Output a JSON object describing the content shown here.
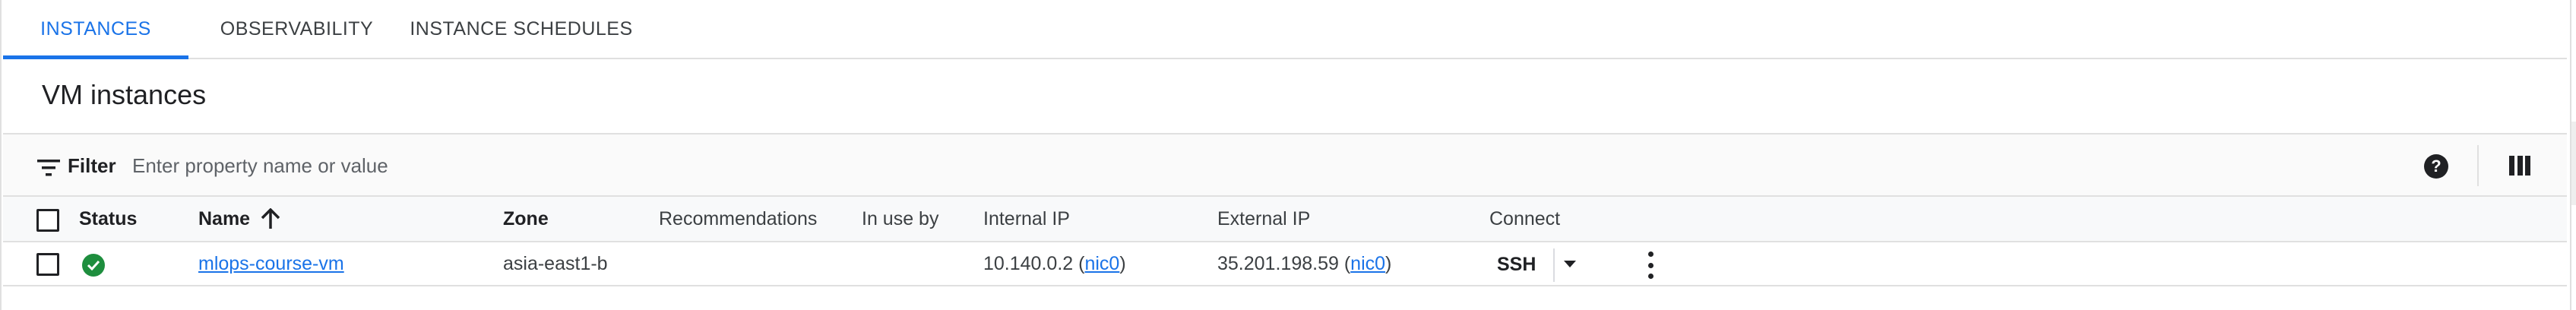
{
  "tabs": [
    {
      "label": "INSTANCES",
      "active": true
    },
    {
      "label": "OBSERVABILITY",
      "active": false
    },
    {
      "label": "INSTANCE SCHEDULES",
      "active": false
    }
  ],
  "page": {
    "title": "VM instances"
  },
  "filter": {
    "label": "Filter",
    "placeholder": "Enter property name or value"
  },
  "toolbar": {
    "help_icon": "help-icon",
    "columns_icon": "column-display-icon",
    "help_glyph": "?"
  },
  "table": {
    "columns": {
      "status": "Status",
      "name": "Name",
      "zone": "Zone",
      "recommendations": "Recommendations",
      "in_use_by": "In use by",
      "internal_ip": "Internal IP",
      "external_ip": "External IP",
      "connect": "Connect"
    },
    "sort": {
      "column": "Name",
      "direction": "ascending"
    },
    "rows": [
      {
        "status": "running",
        "name": "mlops-course-vm",
        "zone": "asia-east1-b",
        "recommendations": "",
        "in_use_by": "",
        "internal_ip": "10.140.0.2",
        "internal_nic": "nic0",
        "external_ip": "35.201.198.59",
        "external_nic": "nic0",
        "connect": "SSH"
      }
    ]
  },
  "colors": {
    "accent": "#1a73e8",
    "status_ok": "#1e8e3e",
    "text": "#202124",
    "border": "#e0e0e0"
  }
}
